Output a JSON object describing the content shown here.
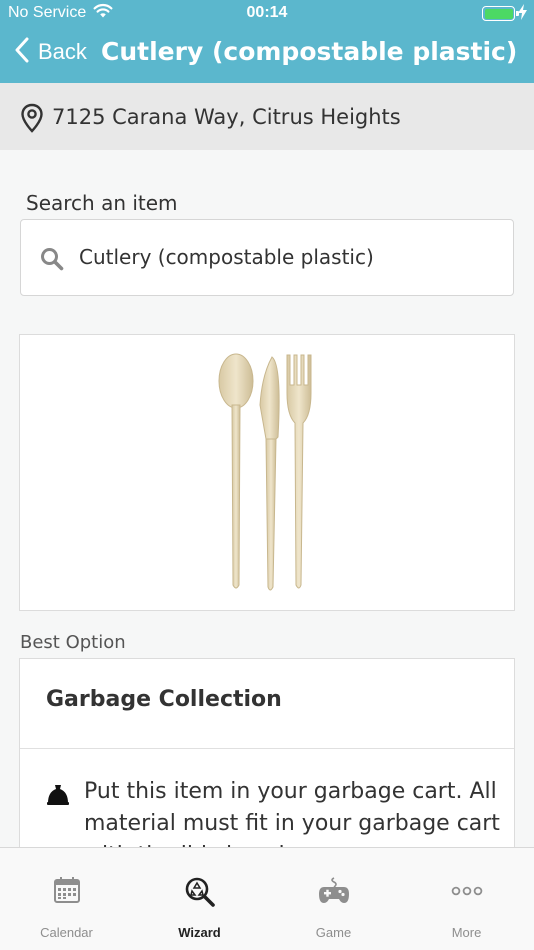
{
  "status_bar": {
    "carrier": "No Service",
    "time": "00:14"
  },
  "nav": {
    "back_label": "Back",
    "title": "Cutlery (compostable plastic)"
  },
  "address": {
    "text": "7125 Carana Way, Citrus Heights"
  },
  "search": {
    "label": "Search an item",
    "value": "Cutlery (compostable plastic)"
  },
  "best_option": {
    "label": "Best Option",
    "title": "Garbage Collection",
    "instruction": "Put this item in your garbage cart. All material must fit in your garbage cart with the lid closed."
  },
  "tabs": [
    {
      "label": "Calendar",
      "icon": "calendar-icon",
      "active": false
    },
    {
      "label": "Wizard",
      "icon": "wizard-search-icon",
      "active": true
    },
    {
      "label": "Game",
      "icon": "gamepad-icon",
      "active": false
    },
    {
      "label": "More",
      "icon": "more-dots-icon",
      "active": false
    }
  ],
  "colors": {
    "header": "#5bb7cd",
    "address_bg": "#e8e8e8",
    "battery": "#4cd964"
  }
}
